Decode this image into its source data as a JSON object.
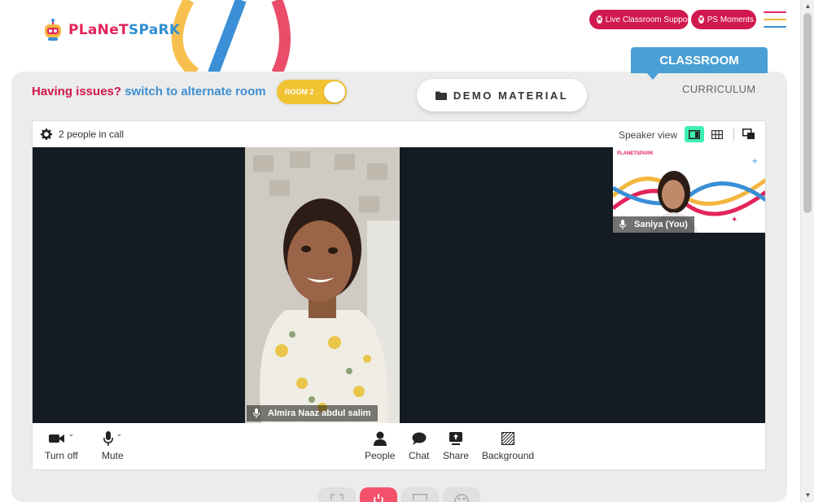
{
  "brand": {
    "logo_text_1": "PLaNeT",
    "logo_text_2": "SPaRK"
  },
  "header": {
    "support_label": "Live Classroom Support",
    "moments_label": "PS Moments"
  },
  "tabs": {
    "classroom": "CLASSROOM",
    "curriculum": "CURRICULUM"
  },
  "issues": {
    "question": "Having issues?",
    "switch_text": "switch to alternate room"
  },
  "room_toggle": {
    "label": "ROOM 2"
  },
  "demo": {
    "label": "DEMO MATERIAL"
  },
  "call": {
    "people_count": "2 people in call",
    "view_label": "Speaker view",
    "main_participant": "Almira Naaz abdul salim",
    "self_participant": "Saniya (You)",
    "self_logo": "PLANETSPARK"
  },
  "controls": {
    "camera": "Turn off",
    "mic": "Mute",
    "people": "People",
    "chat": "Chat",
    "share": "Share",
    "background": "Background"
  },
  "colors": {
    "brand_red": "#d1184f",
    "brand_blue": "#4a9fd5",
    "toggle_yellow": "#f1c232",
    "active_view": "#3ef0b0",
    "power": "#f4516c"
  },
  "icons": {
    "settings": "gear-icon",
    "speaker_view": "speaker-view-icon",
    "grid_view": "grid-view-icon",
    "pip": "picture-in-picture-icon",
    "camera": "video-camera-icon",
    "mic": "microphone-icon",
    "people": "person-icon",
    "chat": "chat-bubble-icon",
    "share": "screen-share-icon",
    "background": "background-icon",
    "folder": "folder-icon"
  }
}
